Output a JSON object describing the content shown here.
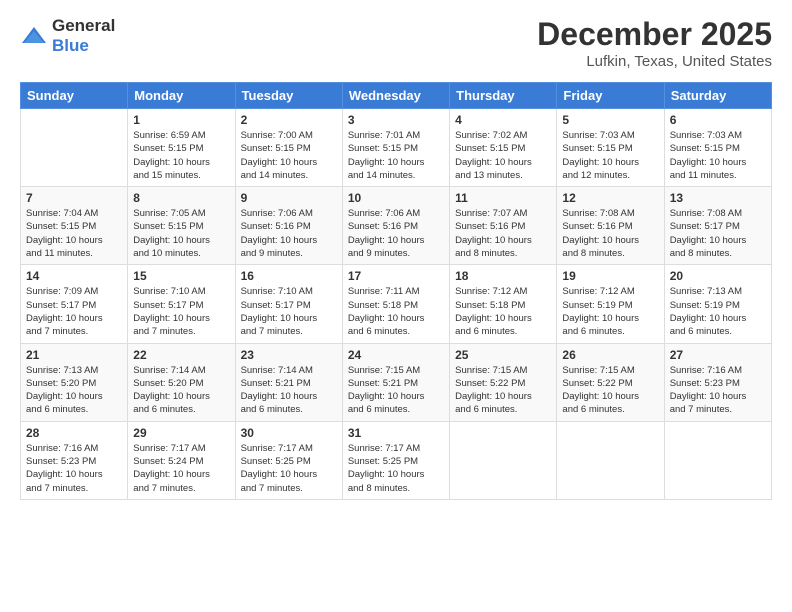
{
  "header": {
    "logo": {
      "general": "General",
      "blue": "Blue"
    },
    "title": "December 2025",
    "location": "Lufkin, Texas, United States"
  },
  "weekdays": [
    "Sunday",
    "Monday",
    "Tuesday",
    "Wednesday",
    "Thursday",
    "Friday",
    "Saturday"
  ],
  "weeks": [
    [
      {
        "day": "",
        "info": ""
      },
      {
        "day": "1",
        "info": "Sunrise: 6:59 AM\nSunset: 5:15 PM\nDaylight: 10 hours\nand 15 minutes."
      },
      {
        "day": "2",
        "info": "Sunrise: 7:00 AM\nSunset: 5:15 PM\nDaylight: 10 hours\nand 14 minutes."
      },
      {
        "day": "3",
        "info": "Sunrise: 7:01 AM\nSunset: 5:15 PM\nDaylight: 10 hours\nand 14 minutes."
      },
      {
        "day": "4",
        "info": "Sunrise: 7:02 AM\nSunset: 5:15 PM\nDaylight: 10 hours\nand 13 minutes."
      },
      {
        "day": "5",
        "info": "Sunrise: 7:03 AM\nSunset: 5:15 PM\nDaylight: 10 hours\nand 12 minutes."
      },
      {
        "day": "6",
        "info": "Sunrise: 7:03 AM\nSunset: 5:15 PM\nDaylight: 10 hours\nand 11 minutes."
      }
    ],
    [
      {
        "day": "7",
        "info": "Sunrise: 7:04 AM\nSunset: 5:15 PM\nDaylight: 10 hours\nand 11 minutes."
      },
      {
        "day": "8",
        "info": "Sunrise: 7:05 AM\nSunset: 5:15 PM\nDaylight: 10 hours\nand 10 minutes."
      },
      {
        "day": "9",
        "info": "Sunrise: 7:06 AM\nSunset: 5:16 PM\nDaylight: 10 hours\nand 9 minutes."
      },
      {
        "day": "10",
        "info": "Sunrise: 7:06 AM\nSunset: 5:16 PM\nDaylight: 10 hours\nand 9 minutes."
      },
      {
        "day": "11",
        "info": "Sunrise: 7:07 AM\nSunset: 5:16 PM\nDaylight: 10 hours\nand 8 minutes."
      },
      {
        "day": "12",
        "info": "Sunrise: 7:08 AM\nSunset: 5:16 PM\nDaylight: 10 hours\nand 8 minutes."
      },
      {
        "day": "13",
        "info": "Sunrise: 7:08 AM\nSunset: 5:17 PM\nDaylight: 10 hours\nand 8 minutes."
      }
    ],
    [
      {
        "day": "14",
        "info": "Sunrise: 7:09 AM\nSunset: 5:17 PM\nDaylight: 10 hours\nand 7 minutes."
      },
      {
        "day": "15",
        "info": "Sunrise: 7:10 AM\nSunset: 5:17 PM\nDaylight: 10 hours\nand 7 minutes."
      },
      {
        "day": "16",
        "info": "Sunrise: 7:10 AM\nSunset: 5:17 PM\nDaylight: 10 hours\nand 7 minutes."
      },
      {
        "day": "17",
        "info": "Sunrise: 7:11 AM\nSunset: 5:18 PM\nDaylight: 10 hours\nand 6 minutes."
      },
      {
        "day": "18",
        "info": "Sunrise: 7:12 AM\nSunset: 5:18 PM\nDaylight: 10 hours\nand 6 minutes."
      },
      {
        "day": "19",
        "info": "Sunrise: 7:12 AM\nSunset: 5:19 PM\nDaylight: 10 hours\nand 6 minutes."
      },
      {
        "day": "20",
        "info": "Sunrise: 7:13 AM\nSunset: 5:19 PM\nDaylight: 10 hours\nand 6 minutes."
      }
    ],
    [
      {
        "day": "21",
        "info": "Sunrise: 7:13 AM\nSunset: 5:20 PM\nDaylight: 10 hours\nand 6 minutes."
      },
      {
        "day": "22",
        "info": "Sunrise: 7:14 AM\nSunset: 5:20 PM\nDaylight: 10 hours\nand 6 minutes."
      },
      {
        "day": "23",
        "info": "Sunrise: 7:14 AM\nSunset: 5:21 PM\nDaylight: 10 hours\nand 6 minutes."
      },
      {
        "day": "24",
        "info": "Sunrise: 7:15 AM\nSunset: 5:21 PM\nDaylight: 10 hours\nand 6 minutes."
      },
      {
        "day": "25",
        "info": "Sunrise: 7:15 AM\nSunset: 5:22 PM\nDaylight: 10 hours\nand 6 minutes."
      },
      {
        "day": "26",
        "info": "Sunrise: 7:15 AM\nSunset: 5:22 PM\nDaylight: 10 hours\nand 6 minutes."
      },
      {
        "day": "27",
        "info": "Sunrise: 7:16 AM\nSunset: 5:23 PM\nDaylight: 10 hours\nand 7 minutes."
      }
    ],
    [
      {
        "day": "28",
        "info": "Sunrise: 7:16 AM\nSunset: 5:23 PM\nDaylight: 10 hours\nand 7 minutes."
      },
      {
        "day": "29",
        "info": "Sunrise: 7:17 AM\nSunset: 5:24 PM\nDaylight: 10 hours\nand 7 minutes."
      },
      {
        "day": "30",
        "info": "Sunrise: 7:17 AM\nSunset: 5:25 PM\nDaylight: 10 hours\nand 7 minutes."
      },
      {
        "day": "31",
        "info": "Sunrise: 7:17 AM\nSunset: 5:25 PM\nDaylight: 10 hours\nand 8 minutes."
      },
      {
        "day": "",
        "info": ""
      },
      {
        "day": "",
        "info": ""
      },
      {
        "day": "",
        "info": ""
      }
    ]
  ]
}
